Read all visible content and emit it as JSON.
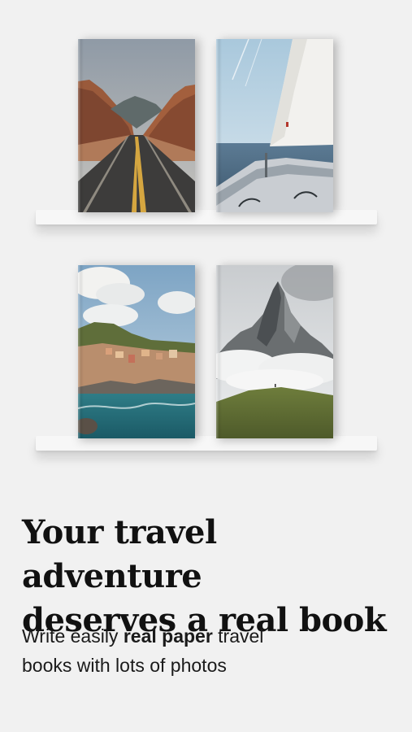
{
  "books": [
    {
      "image": "desert-road-photo"
    },
    {
      "image": "sailboat-photo"
    },
    {
      "image": "coastal-village-photo"
    },
    {
      "image": "mountain-peak-photo"
    }
  ],
  "headline": {
    "line1": "Your travel adventure",
    "line2": "deserves a real book"
  },
  "subtitle": {
    "part1": "Write easily ",
    "bold": "real paper",
    "part2": " travel",
    "line2": "books with lots of photos"
  }
}
